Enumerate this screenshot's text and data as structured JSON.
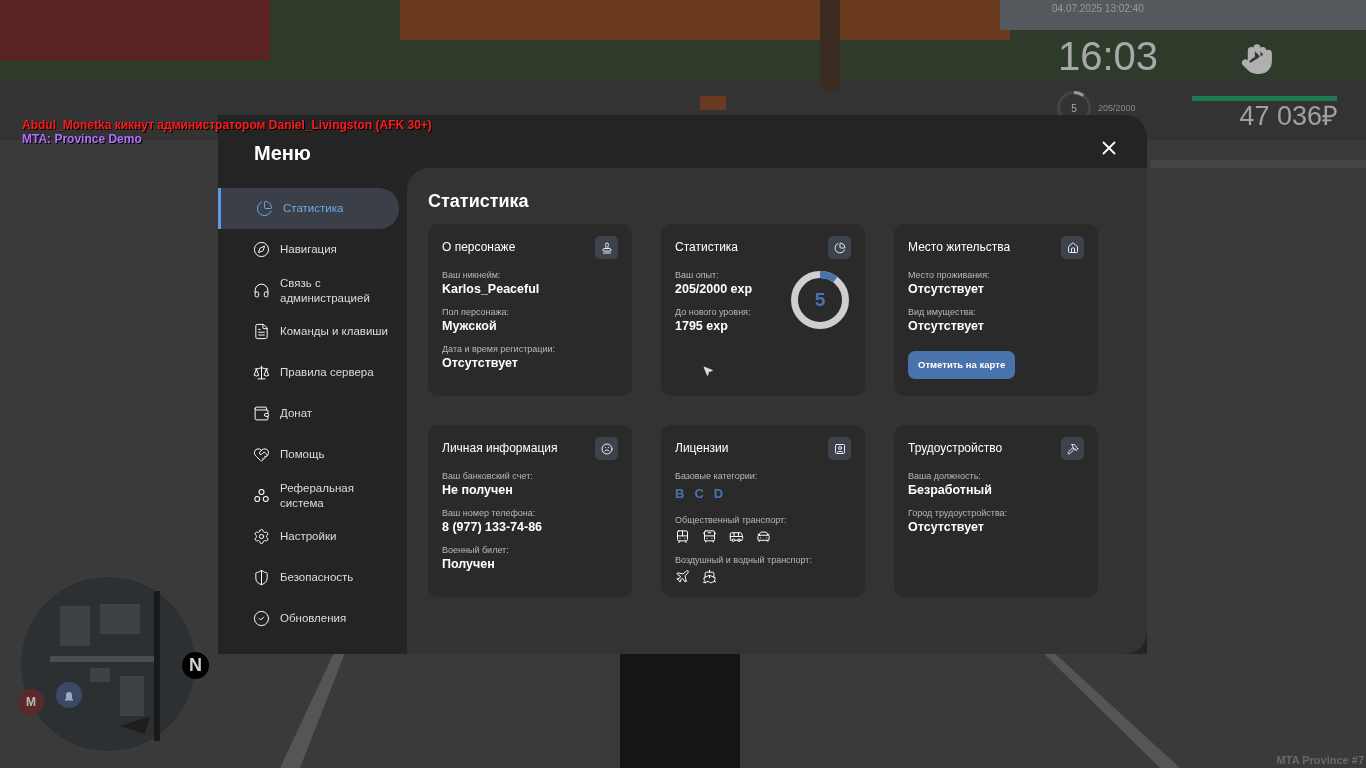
{
  "chat": [
    {
      "text": "Abdul_Monetka кикнут администратором Daniel_Livingston (AFK 30+)",
      "color": "#ff1a1a"
    },
    {
      "text": "MTA: Province Demo",
      "color": "#b070ff"
    }
  ],
  "hud": {
    "datetime": "04.07.2025 13:02:40",
    "clock": "16:03",
    "level": "5",
    "level_progress": {
      "level": 0.1025
    },
    "exp": "205/2000",
    "health": {
      "level": 1
    },
    "money": "47 036₽"
  },
  "minimap": {
    "north": "N",
    "metro": "М"
  },
  "watermark": "MTA Province #7",
  "menu": {
    "title": "Меню",
    "sidebar": [
      {
        "label": "Статистика",
        "selected": true
      },
      {
        "label": "Навигация",
        "selected": false
      },
      {
        "label": "Связь с администрацией",
        "selected": false
      },
      {
        "label": "Команды и клавиши",
        "selected": false
      },
      {
        "label": "Правила сервера",
        "selected": false
      },
      {
        "label": "Донат",
        "selected": false
      },
      {
        "label": "Помощь",
        "selected": false
      },
      {
        "label": "Реферальная система",
        "selected": false
      },
      {
        "label": "Настройки",
        "selected": false
      },
      {
        "label": "Безопасность",
        "selected": false
      },
      {
        "label": "Обновления",
        "selected": false
      }
    ],
    "heading": "Статистика",
    "cards": [
      {
        "kind": "fields",
        "title": "О персонаже",
        "fields": [
          {
            "label": "Ваш никнейм:",
            "value": "Karlos_Peaceful"
          },
          {
            "label": "Пол персонажа:",
            "value": "Мужской"
          },
          {
            "label": "Дата и время регистрации:",
            "value": "Отсутствует"
          }
        ]
      },
      {
        "kind": "stats",
        "title": "Статистика",
        "fields": [
          {
            "label": "Ваш опыт:",
            "value": "205/2000 exp"
          },
          {
            "label": "До нового уровня:",
            "value": "1795 exp"
          }
        ],
        "ring": {
          "value": "5",
          "level": 0.1025
        }
      },
      {
        "kind": "fields",
        "title": "Место жительства",
        "fields": [
          {
            "label": "Место проживания:",
            "value": "Отсутствует"
          },
          {
            "label": "Вид имущества:",
            "value": "Отсутствует"
          }
        ],
        "button": "Отметить на карте"
      },
      {
        "kind": "fields",
        "title": "Личная информация",
        "fields": [
          {
            "label": "Ваш банковский счет:",
            "value": "Не получен"
          },
          {
            "label": "Ваш номер телефона:",
            "value": "8 (977) 133-74-86"
          },
          {
            "label": "Военный билет:",
            "value": "Получен"
          }
        ]
      },
      {
        "kind": "licenses",
        "title": "Лицензии",
        "categories_label": "Базовые категории:",
        "categories": [
          "B",
          "C",
          "D"
        ],
        "groups": [
          {
            "label": "Общественный транспорт:"
          },
          {
            "label": "Воздушный и водный транспорт:"
          }
        ]
      },
      {
        "kind": "fields",
        "title": "Трудоустройство",
        "fields": [
          {
            "label": "Ваша должность:",
            "value": "Безработный"
          },
          {
            "label": "Город трудоустройства:",
            "value": "Отсутствует"
          }
        ]
      }
    ]
  }
}
